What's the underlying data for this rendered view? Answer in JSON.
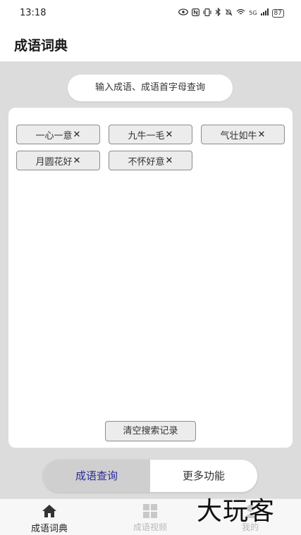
{
  "status_bar": {
    "time": "13:18",
    "signal": "5G",
    "battery": "87"
  },
  "app_bar": {
    "title": "成语词典"
  },
  "search": {
    "placeholder": "输入成语、成语首字母查询"
  },
  "history": {
    "items": [
      {
        "label": "一心一意"
      },
      {
        "label": "九牛一毛"
      },
      {
        "label": "气壮如牛"
      },
      {
        "label": "月圆花好"
      },
      {
        "label": "不怀好意"
      }
    ],
    "remove_glyph": "✕",
    "clear_label": "清空搜索记录"
  },
  "segmented": {
    "left_label": "成语查询",
    "right_label": "更多功能",
    "selected": "成语查询"
  },
  "bottom_nav": {
    "items": [
      {
        "label": "成语词典",
        "icon": "home-icon",
        "active": true
      },
      {
        "label": "成语视频",
        "icon": "grid-icon",
        "active": false
      },
      {
        "label": "我的",
        "icon": "person-icon",
        "active": false
      }
    ]
  },
  "watermark": {
    "text": "大玩客"
  },
  "colors": {
    "accent": "#2a2a9a",
    "background": "#dcdcdc",
    "card": "#ffffff"
  }
}
